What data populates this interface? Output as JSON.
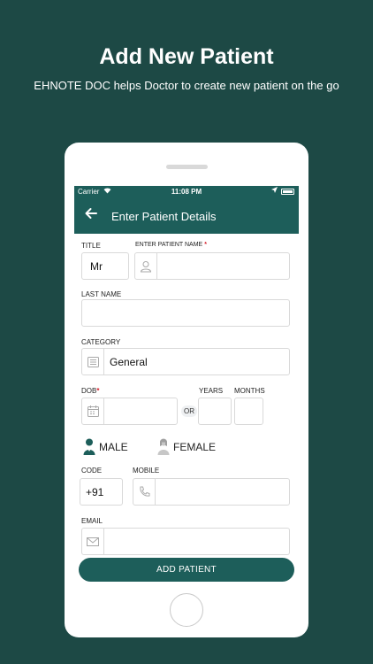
{
  "promo": {
    "headline": "Add New Patient",
    "subline": "EHNOTE DOC helps Doctor to create new patient on the go"
  },
  "status_bar": {
    "carrier": "Carrier",
    "time": "11:08 PM"
  },
  "app_bar": {
    "back_icon": "arrow-left-icon",
    "title": "Enter Patient Details"
  },
  "form": {
    "title_label": "TITLE",
    "title_value": "Mr",
    "patient_name_label": "ENTER PATIENT NAME",
    "required_mark": "*",
    "last_name_label": "LAST NAME",
    "category_label": "CATEGORY",
    "category_value": "General",
    "dob_label": "DOB",
    "or_text": "OR",
    "years_label": "YEARS",
    "months_label": "MONTHS",
    "male_label": "MALE",
    "female_label": "FEMALE",
    "code_label": "CODE",
    "code_value": "+91",
    "mobile_label": "MOBILE",
    "email_label": "EMAIL",
    "submit_label": "ADD PATIENT"
  },
  "colors": {
    "background": "#1d4945",
    "primary": "#1d5e5a",
    "required": "#d61f2c"
  }
}
